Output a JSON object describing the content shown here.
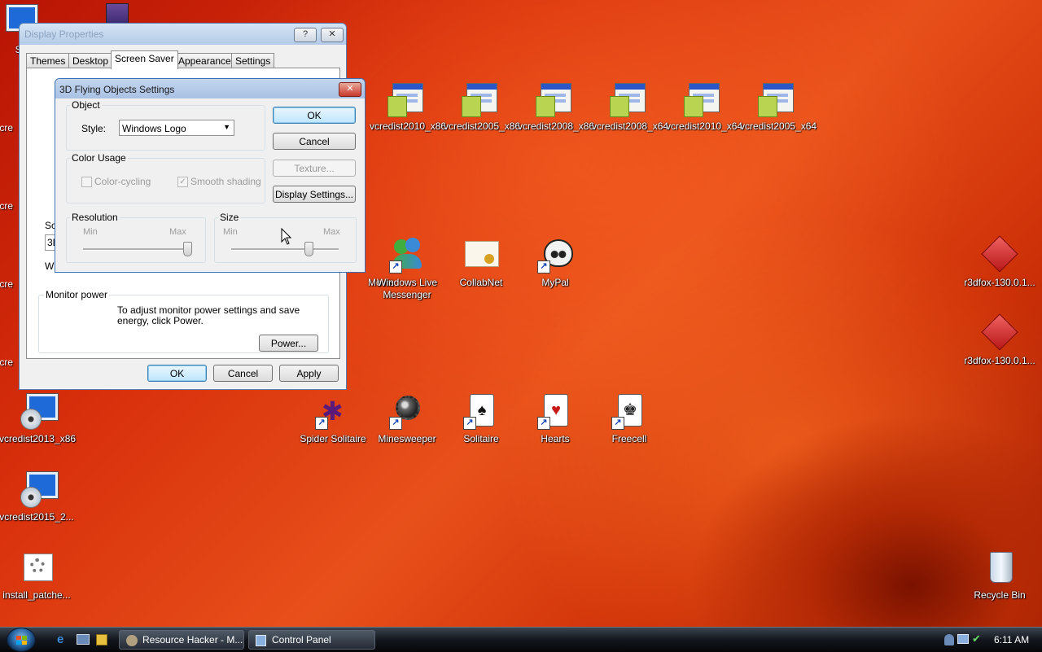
{
  "desktop": {
    "icons": [
      {
        "label": "vcredist2010_x86"
      },
      {
        "label": "vcredist2005_x86"
      },
      {
        "label": "vcredist2008_x86"
      },
      {
        "label": "vcredist2008_x64"
      },
      {
        "label": "vcredist2010_x64"
      },
      {
        "label": "vcredist2005_x64"
      },
      {
        "label": "Movie"
      },
      {
        "label": "Windows Live Messenger"
      },
      {
        "label": "CollabNet"
      },
      {
        "label": "MyPal"
      },
      {
        "label": "r3dfox-130.0.1..."
      },
      {
        "label": "r3dfox-130.0.1..."
      },
      {
        "label": "vcredist2013_x86"
      },
      {
        "label": "vcredist2015_2..."
      },
      {
        "label": "install_patche..."
      },
      {
        "label": "Spider Solitaire"
      },
      {
        "label": "Minesweeper"
      },
      {
        "label": "Solitaire"
      },
      {
        "label": "Hearts"
      },
      {
        "label": "Freecell"
      },
      {
        "label": "Recycle Bin"
      },
      {
        "label": "She"
      },
      {
        "label": "vcre"
      },
      {
        "label": "vcre"
      },
      {
        "label": "vcre"
      },
      {
        "label": "vcre"
      }
    ]
  },
  "display_properties": {
    "title": "Display Properties",
    "help_glyph": "?",
    "close_glyph": "✕",
    "tabs": [
      "Themes",
      "Desktop",
      "Screen Saver",
      "Appearance",
      "Settings"
    ],
    "active_tab": "Screen Saver",
    "screen_saver_label": "Sc",
    "screen_saver_value": "3D",
    "wait_label": "W",
    "monitor_power": {
      "label": "Monitor power",
      "text": "To adjust monitor power settings and save energy, click Power.",
      "power_button": "Power..."
    },
    "buttons": {
      "ok": "OK",
      "cancel": "Cancel",
      "apply": "Apply"
    }
  },
  "flying_objects": {
    "title": "3D Flying Objects Settings",
    "close_glyph": "✕",
    "object_group": "Object",
    "style_label": "Style:",
    "style_value": "Windows Logo",
    "color_group": "Color Usage",
    "color_cycling": {
      "label": "Color-cycling",
      "checked": false,
      "enabled": false
    },
    "smooth_shading": {
      "label": "Smooth shading",
      "checked": true,
      "enabled": false
    },
    "resolution": {
      "label": "Resolution",
      "min": "Min",
      "max": "Max",
      "value_fraction": 1.0
    },
    "size": {
      "label": "Size",
      "min": "Min",
      "max": "Max",
      "value_fraction": 0.72
    },
    "buttons": {
      "ok": "OK",
      "cancel": "Cancel",
      "texture": "Texture...",
      "display_settings": "Display Settings..."
    }
  },
  "taskbar": {
    "tasks": [
      {
        "label": "Resource Hacker - M..."
      },
      {
        "label": "Control Panel"
      }
    ],
    "clock": "6:11 AM"
  },
  "colors": {
    "title_gradient_top": "#c4d6ee",
    "title_gradient_bottom": "#a9c1e4",
    "close_red": "#c8382c",
    "taskbar": "#12161c"
  }
}
